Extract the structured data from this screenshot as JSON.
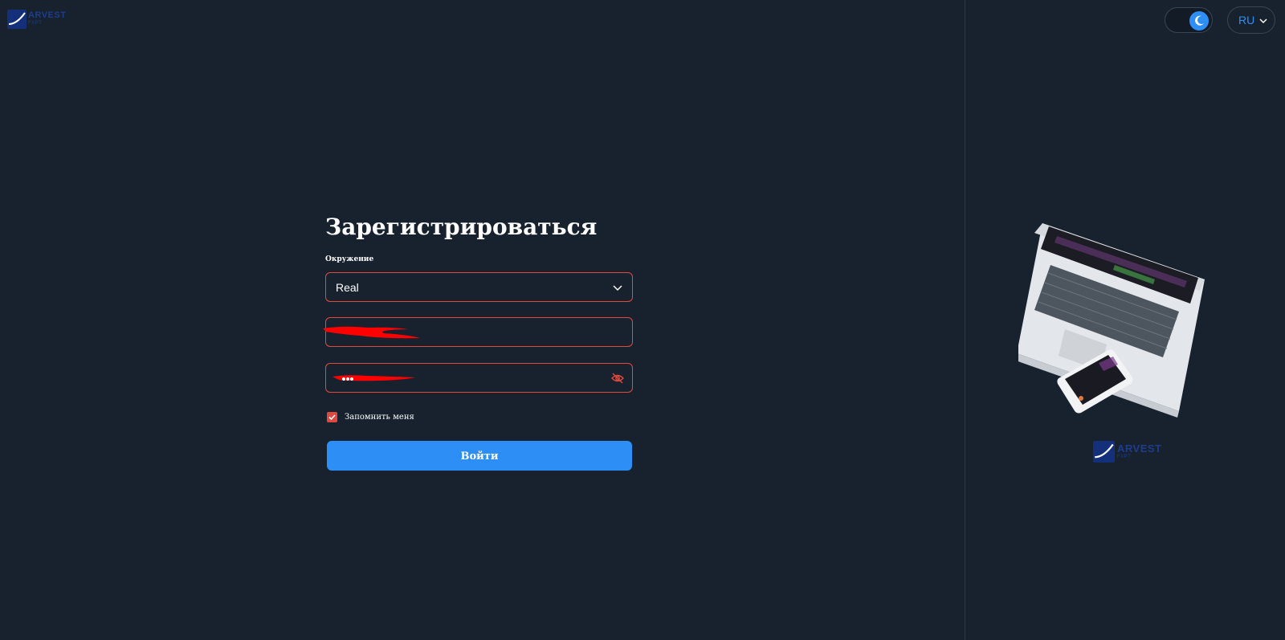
{
  "brand": {
    "name": "ARVEST",
    "tagline": "FXPT",
    "color": "#1e3c8c",
    "mark_color": "#14307a"
  },
  "header": {
    "theme_toggle": {
      "mode": "dark",
      "icon": "moon-icon"
    },
    "language": {
      "value": "RU",
      "icon": "chevron-down-icon"
    }
  },
  "form": {
    "title": "Зарегистрироваться",
    "environment_label": "Окружение",
    "environment_value": "Real",
    "environment_options": [
      "Real"
    ],
    "email_value": "",
    "password_value": "",
    "password_toggle_icon": "eye-off-icon",
    "remember_me": {
      "label": "Запомнить меня",
      "checked": true
    },
    "submit_label": "Войти"
  },
  "colors": {
    "background": "#18222f",
    "accent": "#2d8ef5",
    "error_border": "#e0493f",
    "redaction": "#ff0000"
  }
}
